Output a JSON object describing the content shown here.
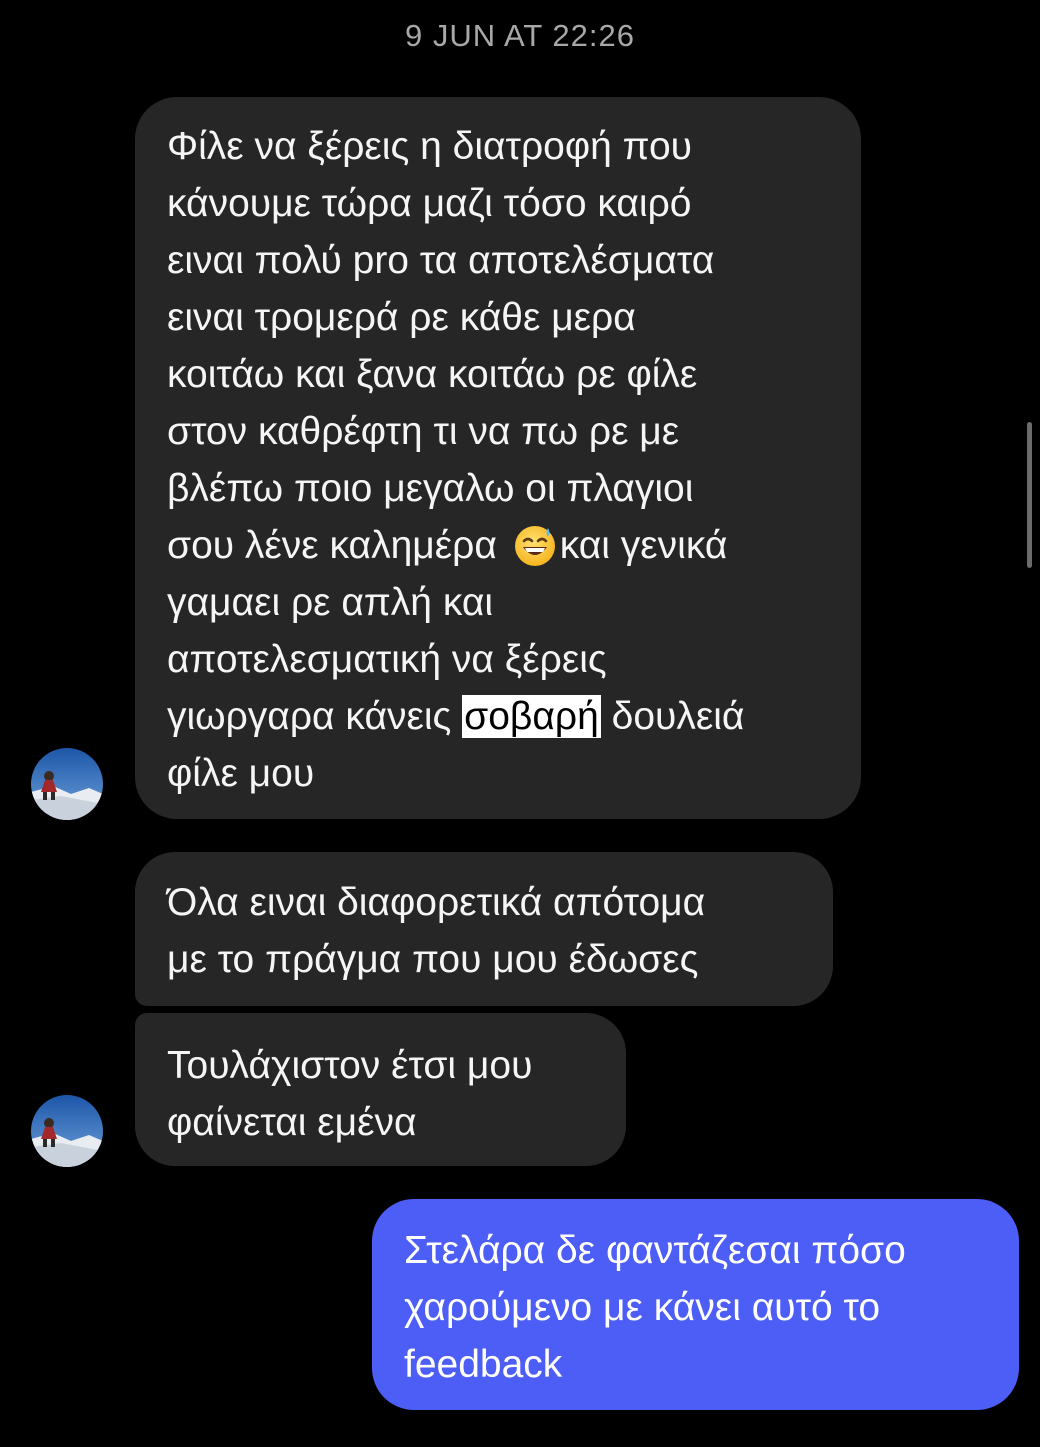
{
  "conversation": {
    "timestamp": "9 JUN AT 22:26",
    "messages": [
      {
        "sender": "other",
        "lines": [
          "Φίλε να ξέρεις η διατροφή που",
          "κάνουμε τώρα μαζι τόσο καιρό",
          "ειναι πολύ pro τα αποτελέσματα",
          "ειναι τρομερά ρε κάθε μερα",
          "κοιτάω και ξανα κοιτάω ρε φίλε",
          "στον καθρέφτη τι να πω ρε με",
          "βλέπω ποιο μεγαλω οι πλαγιοι"
        ],
        "line8_before_emoji": "σου λένε καλημέρα ",
        "emoji": "grinning-face-with-sweat-emoji",
        "line8_after_emoji": "και γενικά",
        "lines_b": [
          "γαμαει ρε απλή και",
          "αποτελεσματική να ξέρεις"
        ],
        "line11_before": "γιωργαρα κάνεις ",
        "line11_highlight": "σοβαρή",
        "line11_after": " δουλειά",
        "last_line": "φίλε μου"
      },
      {
        "sender": "other",
        "lines": [
          "Όλα ειναι διαφορετικά απότομα",
          "με το πράγμα που μου έδωσες"
        ]
      },
      {
        "sender": "other",
        "lines": [
          "Τουλάχιστον έτσι μου",
          "φαίνεται εμένα"
        ]
      },
      {
        "sender": "me",
        "lines": [
          "Στελάρα δε φαντάζεσαι πόσο",
          "χαρούμενο με κάνει αυτό το",
          "feedback"
        ]
      }
    ]
  },
  "colors": {
    "background": "#000000",
    "incoming_bubble": "#262626",
    "outgoing_bubble": "#4d5ef6",
    "timestamp_text": "#a8a8a8",
    "highlight": "#ffffff"
  },
  "icons": {
    "avatar": "profile-photo-avatar",
    "emoji": "grinning-face-with-sweat-emoji"
  }
}
